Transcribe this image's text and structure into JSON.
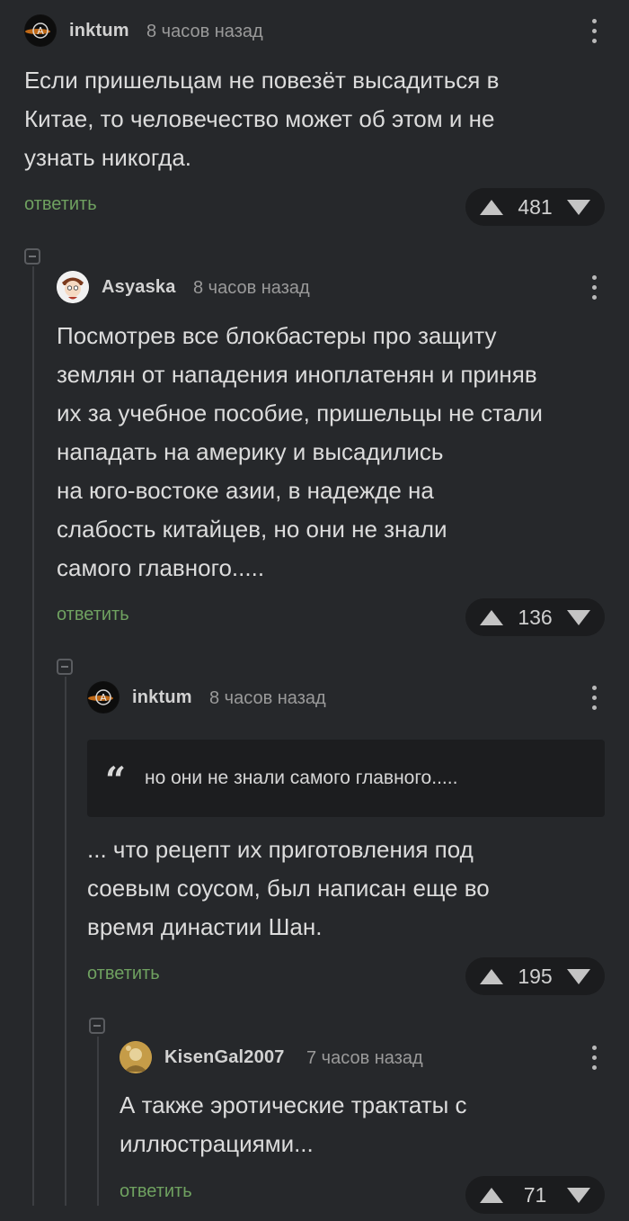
{
  "comments": [
    {
      "username": "inktum",
      "time": "8 часов назад",
      "text": [
        "Если пришельцам не повезёт высадиться в",
        "Китае, то человечество может об этом и не",
        "узнать никогда."
      ],
      "reply_label": "ответить",
      "votes": "481"
    },
    {
      "username": "Asyaska",
      "time": "8 часов назад",
      "text": [
        "Посмотрев все блокбастеры про защиту",
        "землян от нападения иноплатенян и приняв",
        "их за учебное пособие, пришельцы не стали",
        "нападать на америку и высадились",
        "на юго-востоке азии, в надежде на",
        "слабость китайцев, но они не знали",
        "самого главного....."
      ],
      "reply_label": "ответить",
      "votes": "136"
    },
    {
      "username": "inktum",
      "time": "8 часов назад",
      "quote": "но они не знали самого главного.....",
      "text": [
        "... что рецепт их приготовления под",
        "соевым соусом, был написан еще во",
        "время династии Шан."
      ],
      "reply_label": "ответить",
      "votes": "195"
    },
    {
      "username": "KisenGal2007",
      "time": "7 часов назад",
      "text": [
        "А также эротические трактаты с",
        "иллюстрациями..."
      ],
      "reply_label": "ответить",
      "votes": "71"
    }
  ],
  "icons": {
    "upvote": "triangle-up-icon",
    "downvote": "triangle-down-icon",
    "menu": "more-vertical-icon",
    "collapse": "collapse-minus-icon",
    "quote": "quote-icon"
  },
  "colors": {
    "background": "#26282b",
    "reply_link": "#6fa160",
    "vote_pill": "#1b1c1e",
    "quote_bg": "#1c1d1f"
  }
}
